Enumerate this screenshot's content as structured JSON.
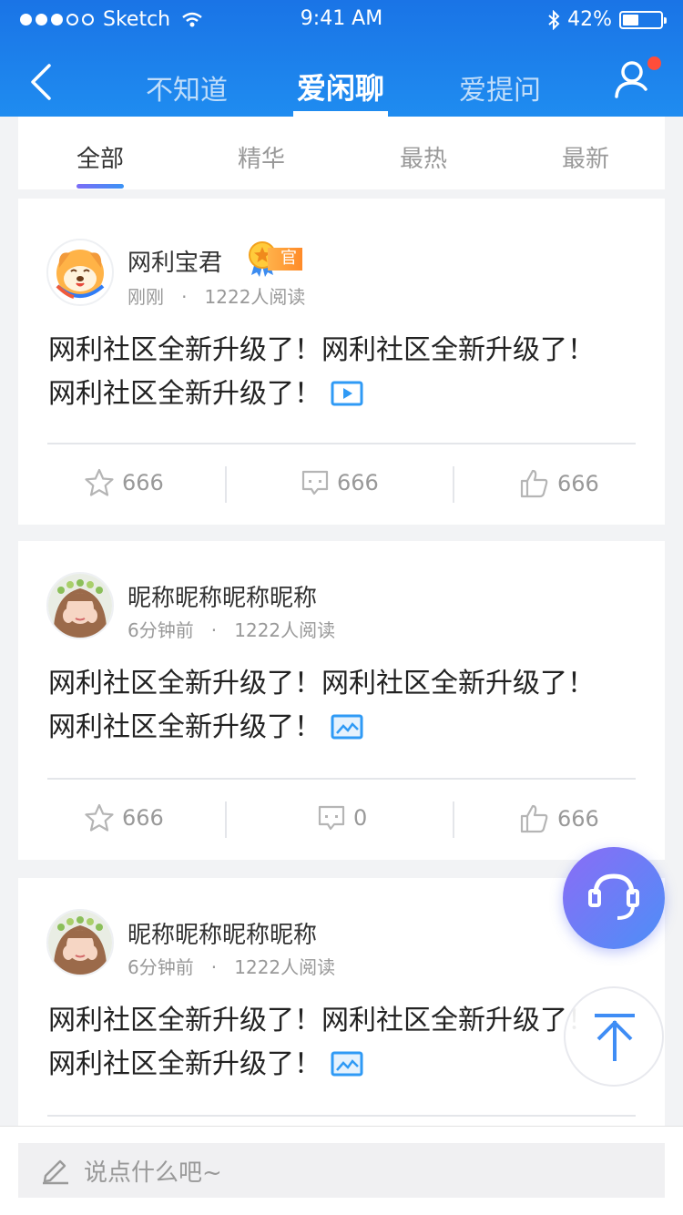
{
  "status_bar": {
    "carrier": "Sketch",
    "time": "9:41 AM",
    "battery": "42%",
    "battery_level": 0.42
  },
  "nav": {
    "tabs": [
      {
        "label": "不知道"
      },
      {
        "label": "爱闲聊",
        "active": true
      },
      {
        "label": "爱提问"
      }
    ],
    "has_notification": true
  },
  "filter_tabs": [
    {
      "label": "全部",
      "active": true
    },
    {
      "label": "精华"
    },
    {
      "label": "最热"
    },
    {
      "label": "最新"
    }
  ],
  "posts": [
    {
      "author": "网利宝君",
      "badge": "官",
      "time": "刚刚",
      "reads": "1222人阅读",
      "content_line1": "网利社区全新升级了！网利社区全新升级了！",
      "content_line2": "网利社区全新升级了！",
      "media": "video-icon",
      "favorites": "666",
      "comments": "666",
      "likes": "666"
    },
    {
      "author": "昵称昵称昵称昵称",
      "time": "6分钟前",
      "reads": "1222人阅读",
      "content_line1": "网利社区全新升级了！网利社区全新升级了！",
      "content_line2": "网利社区全新升级了！",
      "media": "image-icon",
      "favorites": "666",
      "comments": "0",
      "likes": "666"
    },
    {
      "author": "昵称昵称昵称昵称",
      "time": "6分钟前",
      "reads": "1222人阅读",
      "content_line1": "网利社区全新升级了！网利社区全新升级了！",
      "content_line2": "网利社区全新升级了！",
      "media": "image-icon"
    }
  ],
  "input": {
    "placeholder": "说点什么吧~"
  },
  "colors": {
    "primary": "#1a74e6",
    "accent_gradient_start": "#7b6cf6",
    "accent_gradient_end": "#3b93f5",
    "notification": "#ff4d3a",
    "badge": "#ff8a28"
  }
}
